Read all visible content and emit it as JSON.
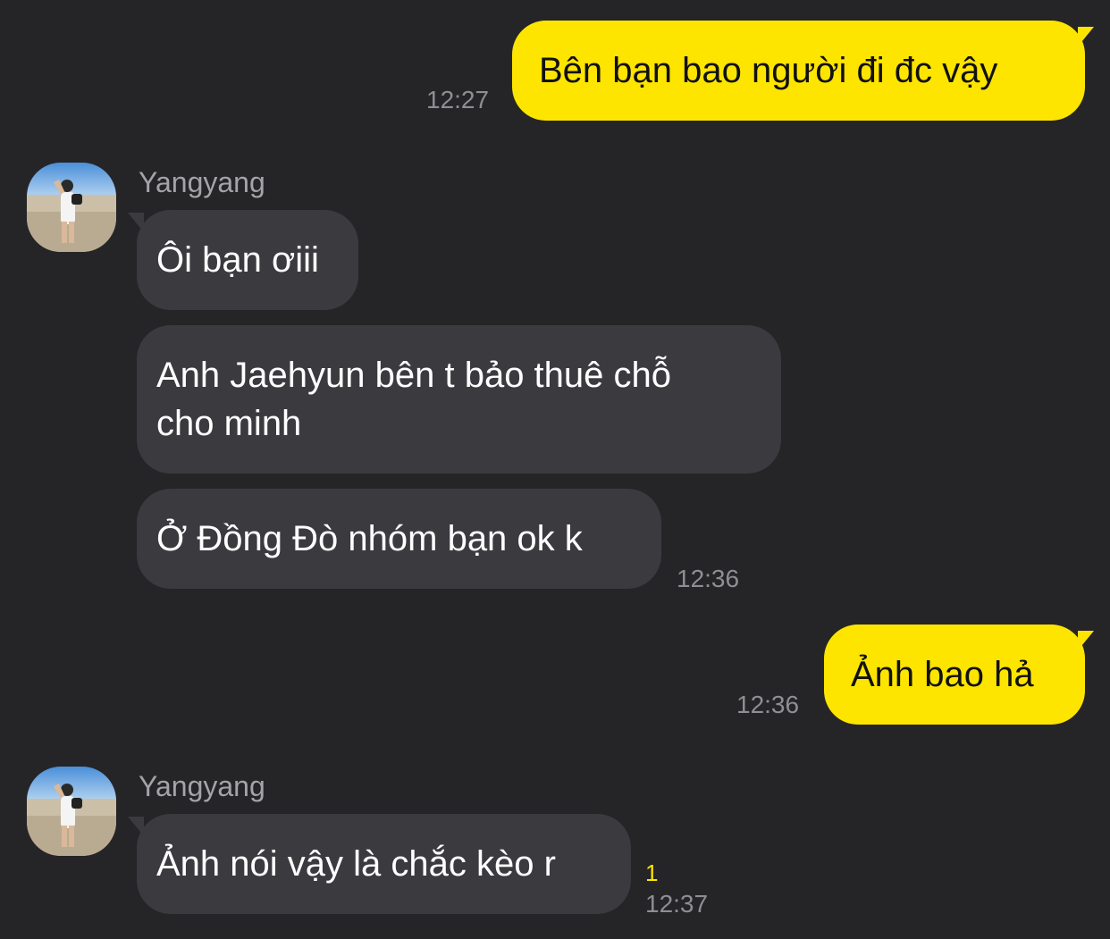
{
  "conversation": {
    "messages": [
      {
        "direction": "outgoing",
        "text": "Bên bạn bao người đi đc vậy",
        "time": "12:27"
      },
      {
        "direction": "incoming",
        "sender": "Yangyang",
        "avatar_icon": "user-avatar-photo",
        "group": [
          {
            "text": "Ôi bạn ơiii"
          },
          {
            "text": "Anh Jaehyun bên t bảo thuê chỗ\ncho minh"
          },
          {
            "text": "Ở Đồng Đò nhóm bạn ok k",
            "time": "12:36"
          }
        ]
      },
      {
        "direction": "outgoing",
        "text": "Ảnh bao hả",
        "time": "12:36"
      },
      {
        "direction": "incoming",
        "sender": "Yangyang",
        "avatar_icon": "user-avatar-photo",
        "group": [
          {
            "text": "Ảnh nói vậy là chắc kèo r",
            "time": "12:37",
            "unread_count": "1"
          }
        ]
      }
    ]
  },
  "colors": {
    "background": "#252527",
    "outgoing_bubble": "#fee500",
    "incoming_bubble": "#3b3b3f",
    "timestamp": "#8e8e93",
    "unread": "#fee500"
  }
}
